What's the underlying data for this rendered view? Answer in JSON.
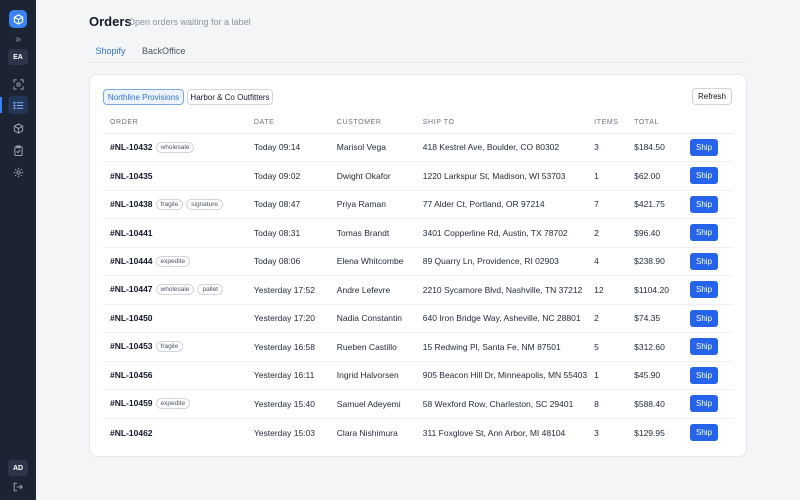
{
  "sidebar": {
    "workspace_initials": "EA",
    "user_initials": "AD",
    "expand_glyph": "»",
    "nav": [
      {
        "icon": "scan-icon"
      },
      {
        "icon": "list-icon"
      },
      {
        "icon": "box-icon"
      },
      {
        "icon": "clipboard-icon"
      },
      {
        "icon": "gear-icon"
      }
    ],
    "accent": "#3b82f6",
    "bg": "#1c2333"
  },
  "header": {
    "title": "Orders",
    "subtitle": "Open orders waiting for a label"
  },
  "tabs": [
    {
      "label": "Shopify"
    },
    {
      "label": "BackOffice"
    }
  ],
  "stores": [
    {
      "label": "Northline Provisions"
    },
    {
      "label": "Harbor & Co Outfitters"
    }
  ],
  "refresh_label": "Refresh",
  "columns": {
    "order": "ORDER",
    "date": "DATE",
    "customer": "CUSTOMER",
    "ship_to": "SHIP TO",
    "items": "ITEMS",
    "total": "TOTAL"
  },
  "ship_label": "Ship",
  "orders": [
    {
      "id": "#NL-10432",
      "tags": [
        "wholesale"
      ],
      "date": "Today 09:14",
      "customer": "Marisol Vega",
      "ship_to": "418 Kestrel Ave, Boulder, CO 80302",
      "items": "3",
      "total": "$184.50"
    },
    {
      "id": "#NL-10435",
      "tags": [],
      "date": "Today 09:02",
      "customer": "Dwight Okafor",
      "ship_to": "1220 Larkspur St, Madison, WI 53703",
      "items": "1",
      "total": "$62.00"
    },
    {
      "id": "#NL-10438",
      "tags": [
        "fragile",
        "signature"
      ],
      "date": "Today 08:47",
      "customer": "Priya Raman",
      "ship_to": "77 Alder Ct, Portland, OR 97214",
      "items": "7",
      "total": "$421.75"
    },
    {
      "id": "#NL-10441",
      "tags": [],
      "date": "Today 08:31",
      "customer": "Tomas Brandt",
      "ship_to": "3401 Copperline Rd, Austin, TX 78702",
      "items": "2",
      "total": "$96.40"
    },
    {
      "id": "#NL-10444",
      "tags": [
        "expedite"
      ],
      "date": "Today 08:06",
      "customer": "Elena Whitcombe",
      "ship_to": "89 Quarry Ln, Providence, RI 02903",
      "items": "4",
      "total": "$238.90"
    },
    {
      "id": "#NL-10447",
      "tags": [
        "wholesale",
        "pallet"
      ],
      "date": "Yesterday 17:52",
      "customer": "Andre Lefevre",
      "ship_to": "2210 Sycamore Blvd, Nashville, TN 37212",
      "items": "12",
      "total": "$1104.20"
    },
    {
      "id": "#NL-10450",
      "tags": [],
      "date": "Yesterday 17:20",
      "customer": "Nadia Constantin",
      "ship_to": "640 Iron Bridge Way, Asheville, NC 28801",
      "items": "2",
      "total": "$74.35"
    },
    {
      "id": "#NL-10453",
      "tags": [
        "fragile"
      ],
      "date": "Yesterday 16:58",
      "customer": "Rueben Castillo",
      "ship_to": "15 Redwing Pl, Santa Fe, NM 87501",
      "items": "5",
      "total": "$312.60"
    },
    {
      "id": "#NL-10456",
      "tags": [],
      "date": "Yesterday 16:11",
      "customer": "Ingrid Halvorsen",
      "ship_to": "905 Beacon Hill Dr, Minneapolis, MN 55403",
      "items": "1",
      "total": "$45.90"
    },
    {
      "id": "#NL-10459",
      "tags": [
        "expedite"
      ],
      "date": "Yesterday 15:40",
      "customer": "Samuel Adeyemi",
      "ship_to": "58 Wexford Row, Charleston, SC 29401",
      "items": "8",
      "total": "$588.40"
    },
    {
      "id": "#NL-10462",
      "tags": [],
      "date": "Yesterday 15:03",
      "customer": "Clara Nishimura",
      "ship_to": "311 Foxglove St, Ann Arbor, MI 48104",
      "items": "3",
      "total": "$129.95"
    }
  ]
}
